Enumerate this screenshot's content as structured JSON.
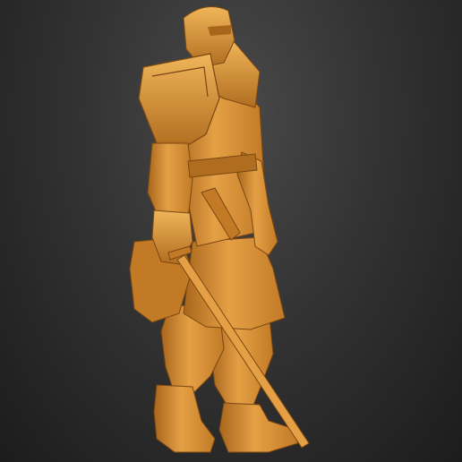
{
  "scene": {
    "subject_icon": "armored-warrior-sculpt",
    "colors": {
      "background_top": "#4a4a4a",
      "background_bottom": "#1c1c1c",
      "material_base": "#d9902f",
      "material_light": "#f0b55a",
      "material_dark": "#a8661c",
      "material_shadow": "#7a4712"
    }
  }
}
